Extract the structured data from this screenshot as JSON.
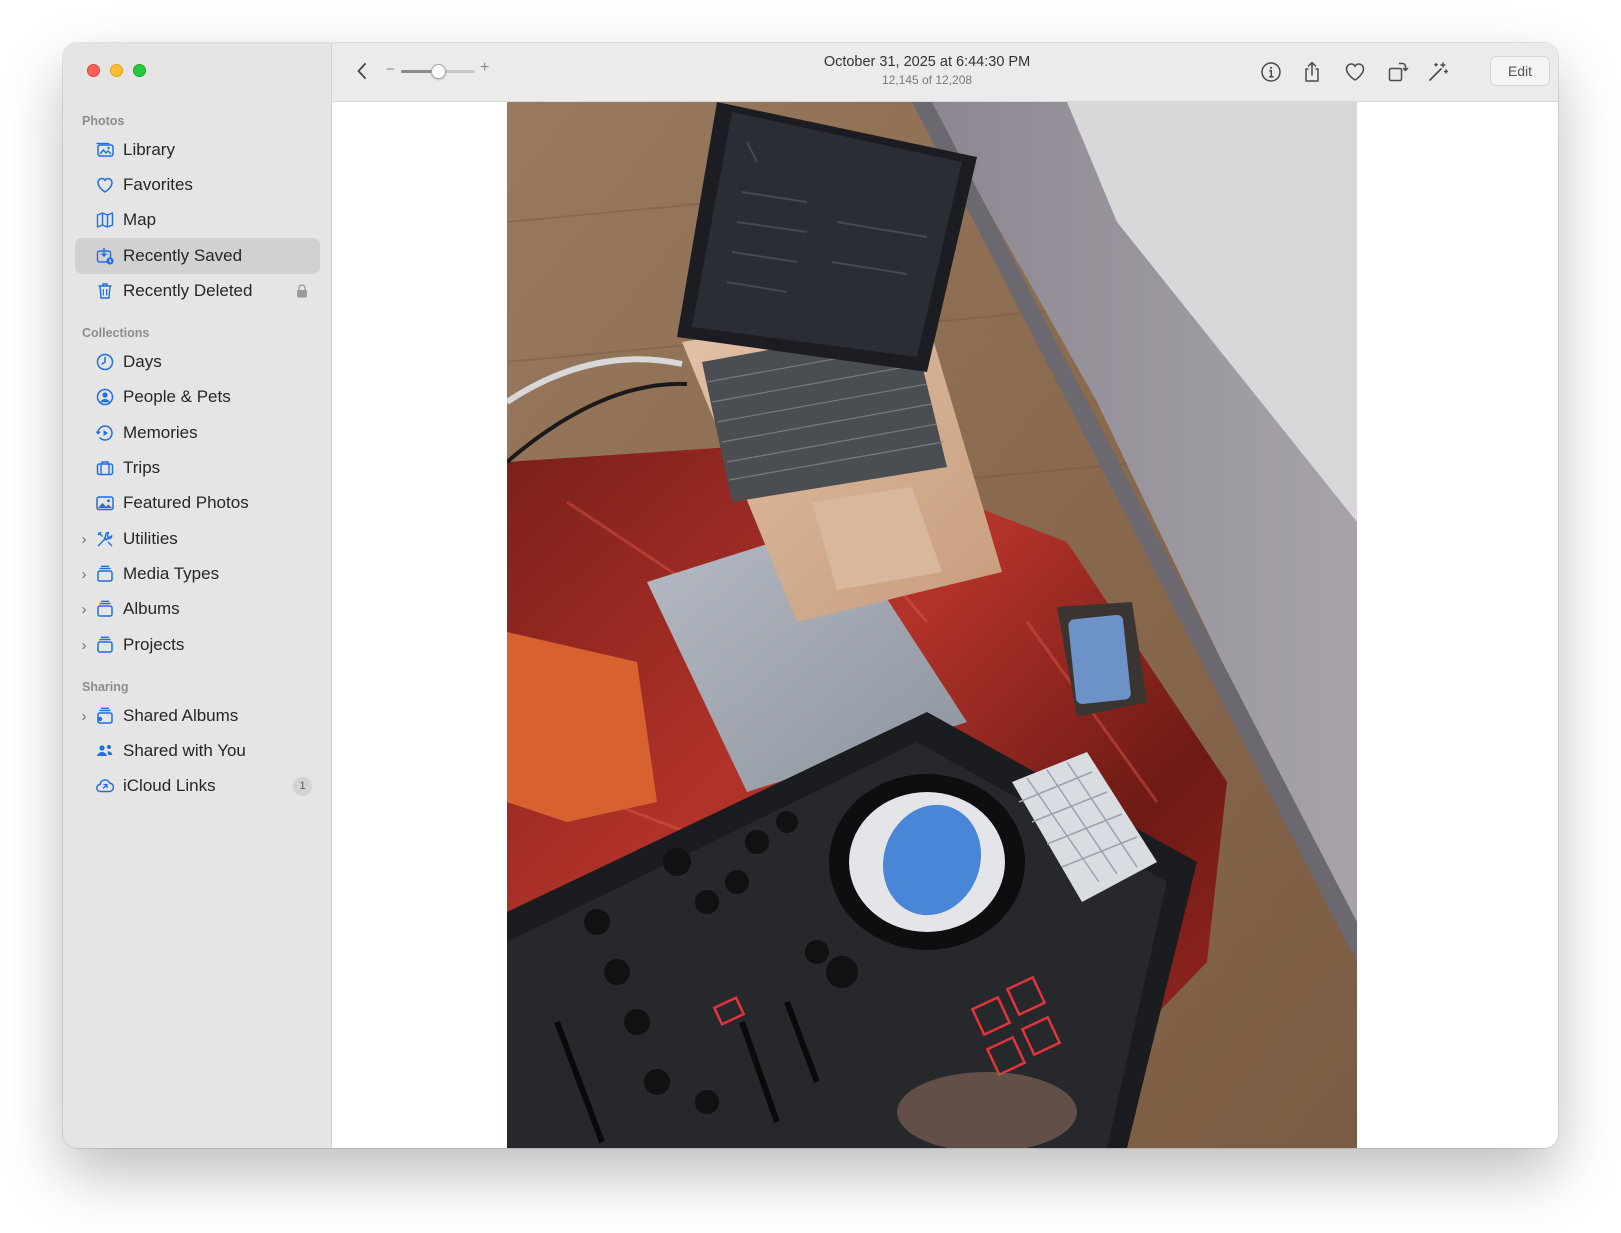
{
  "window": {
    "traffic_lights": [
      "close",
      "minimize",
      "zoom"
    ]
  },
  "sidebar": {
    "sections": [
      {
        "title": "Photos",
        "items": [
          {
            "label": "Library",
            "icon": "library-icon"
          },
          {
            "label": "Favorites",
            "icon": "heart-icon"
          },
          {
            "label": "Map",
            "icon": "map-icon"
          },
          {
            "label": "Recently Saved",
            "icon": "recently-saved-icon",
            "selected": true
          },
          {
            "label": "Recently Deleted",
            "icon": "trash-icon",
            "badge_icon": "lock-icon"
          }
        ]
      },
      {
        "title": "Collections",
        "items": [
          {
            "label": "Days",
            "icon": "clock-icon"
          },
          {
            "label": "People & Pets",
            "icon": "person-circle-icon"
          },
          {
            "label": "Memories",
            "icon": "memories-icon"
          },
          {
            "label": "Trips",
            "icon": "suitcase-icon"
          },
          {
            "label": "Featured Photos",
            "icon": "photo-icon"
          },
          {
            "label": "Utilities",
            "icon": "tools-icon",
            "expandable": true
          },
          {
            "label": "Media Types",
            "icon": "stack-icon",
            "expandable": true
          },
          {
            "label": "Albums",
            "icon": "stack-icon",
            "expandable": true
          },
          {
            "label": "Projects",
            "icon": "stack-icon",
            "expandable": true
          }
        ]
      },
      {
        "title": "Sharing",
        "items": [
          {
            "label": "Shared Albums",
            "icon": "shared-albums-icon",
            "expandable": true
          },
          {
            "label": "Shared with You",
            "icon": "shared-with-you-icon"
          },
          {
            "label": "iCloud Links",
            "icon": "icloud-link-icon",
            "count": "1"
          }
        ]
      }
    ]
  },
  "toolbar": {
    "title": "October 31, 2025 at 6:44:30 PM",
    "subtitle": "12,145 of 12,208",
    "zoom_minus": "−",
    "zoom_plus": "+",
    "zoom_level": 0.5,
    "edit_label": "Edit",
    "icons": [
      "info-icon",
      "share-icon",
      "heart-icon",
      "rotate-icon",
      "magic-wand-icon"
    ]
  },
  "photo": {
    "description_icon": "photo-viewer"
  },
  "colors": {
    "accent": "#1f6fe5",
    "sidebar_bg": "#e6e5e5",
    "selected_bg": "#d2d1d1"
  }
}
